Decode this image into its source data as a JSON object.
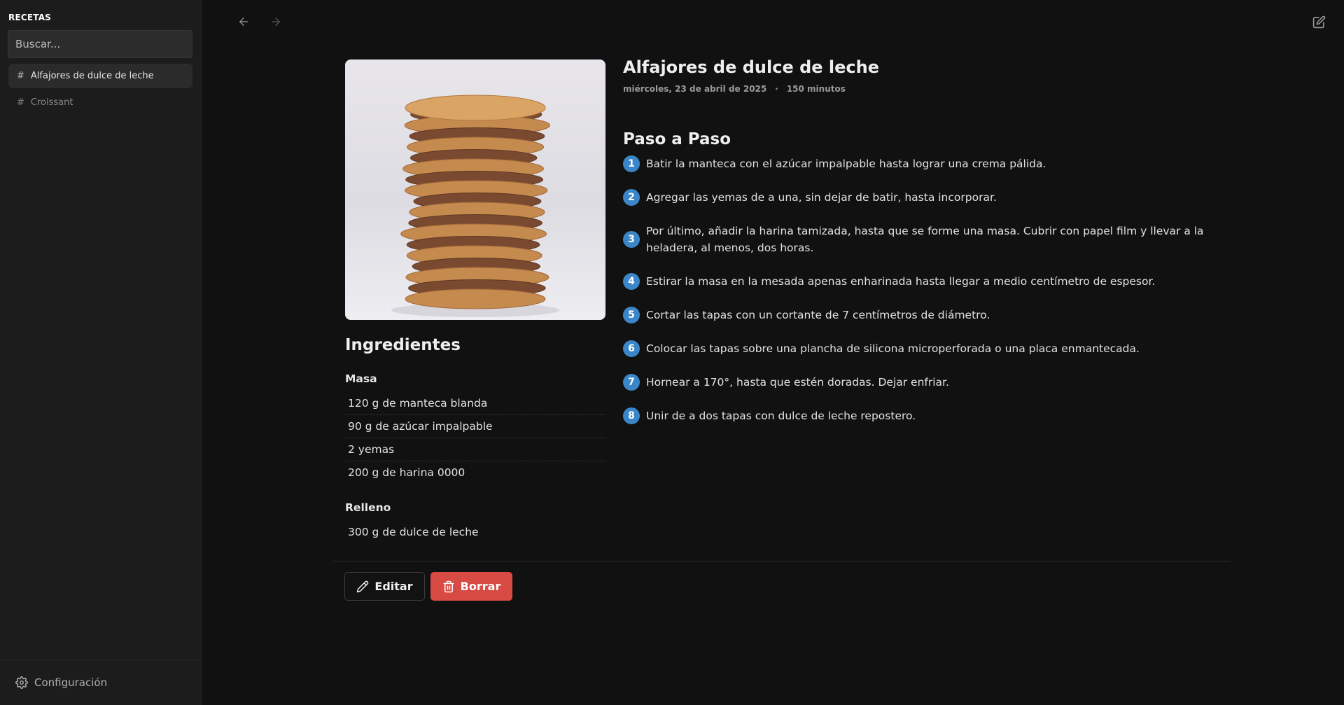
{
  "sidebar": {
    "title": "RECETAS",
    "search_placeholder": "Buscar...",
    "items": [
      {
        "label": "Alfajores de dulce de leche",
        "active": true
      },
      {
        "label": "Croissant",
        "active": false
      }
    ],
    "footer_label": "Configuración"
  },
  "recipe": {
    "title": "Alfajores de dulce de leche",
    "date": "miércoles, 23 de abril de 2025",
    "separator": "·",
    "duration": "150 minutos",
    "steps_title": "Paso a Paso",
    "steps": [
      {
        "num": "1",
        "text": "Batir la manteca con el azúcar impalpable hasta lograr una crema pálida."
      },
      {
        "num": "2",
        "text": "Agregar las yemas de a una, sin dejar de batir, hasta incorporar."
      },
      {
        "num": "3",
        "text": "Por último, añadir la harina tamizada, hasta que se forme una masa. Cubrir con papel film y llevar a la heladera, al menos, dos horas."
      },
      {
        "num": "4",
        "text": "Estirar la masa en la mesada apenas enharinada hasta llegar a medio centímetro de espesor."
      },
      {
        "num": "5",
        "text": "Cortar las tapas con un cortante de 7 centímetros de diámetro."
      },
      {
        "num": "6",
        "text": "Colocar las tapas sobre una plancha de silicona microperforada o una placa enmantecada."
      },
      {
        "num": "7",
        "text": "Hornear a 170°, hasta que estén doradas. Dejar enfriar."
      },
      {
        "num": "8",
        "text": "Unir de a dos tapas con dulce de leche repostero."
      }
    ],
    "ingredients_title": "Ingredientes",
    "groups": [
      {
        "name": "Masa",
        "items": [
          "120 g de manteca blanda",
          "90 g de azúcar impalpable",
          "2 yemas",
          "200 g de harina 0000"
        ]
      },
      {
        "name": "Relleno",
        "items": [
          "300 g de dulce de leche"
        ]
      }
    ]
  },
  "actions": {
    "edit_label": "Editar",
    "delete_label": "Borrar"
  },
  "colors": {
    "accent": "#3a86c8",
    "danger": "#d84a44",
    "background": "#111111",
    "sidebar": "#1c1c1c"
  },
  "icons": {
    "back": "arrow-left-icon",
    "forward": "arrow-right-icon",
    "compose": "edit-square-icon",
    "settings": "gear-icon",
    "edit": "pencil-icon",
    "delete": "trash-icon"
  }
}
